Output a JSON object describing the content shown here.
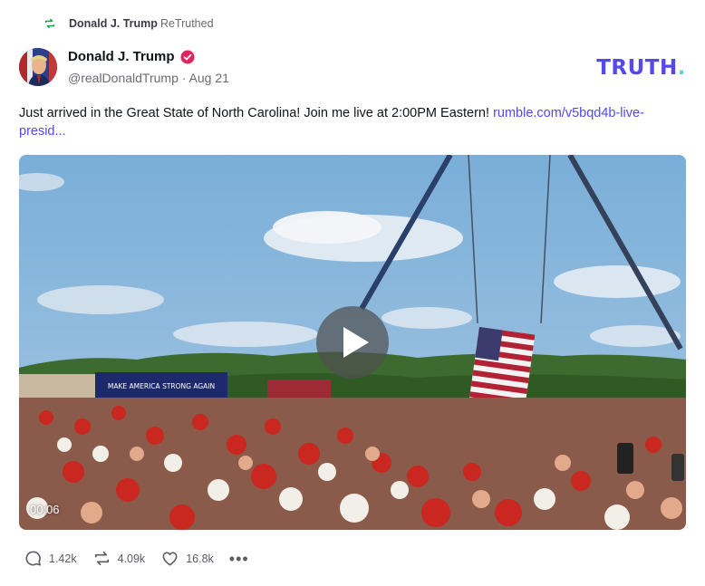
{
  "retruth": {
    "name": "Donald J. Trump",
    "verb": "ReTruthed",
    "icon": "retruth-icon"
  },
  "post": {
    "author_name": "Donald J. Trump",
    "verified_icon": "verified-badge-icon",
    "handle": "@realDonaldTrump",
    "date": "Aug 21",
    "meta_line": "@realDonaldTrump · Aug 21",
    "brand_logo": "TRUTH",
    "brand_dot": ".",
    "text": "Just arrived in the Great State of North Carolina! Join me live at 2:00PM Eastern! ",
    "link_text": "rumble.com/v5bqd4b-live-presid..."
  },
  "video": {
    "timecode": "00:06",
    "banner_text": "MAKE AMERICA STRONG AGAIN",
    "play_icon": "play-icon",
    "progress": 0
  },
  "actions": {
    "replies": "1.42k",
    "retruths": "4.09k",
    "likes": "16.8k",
    "more": "•••"
  },
  "colors": {
    "brand": "#5448ee",
    "brand_dot": "#62d3d0",
    "verified": "#e0245e",
    "retruth_green": "#17a34a",
    "link": "#5448ee"
  }
}
